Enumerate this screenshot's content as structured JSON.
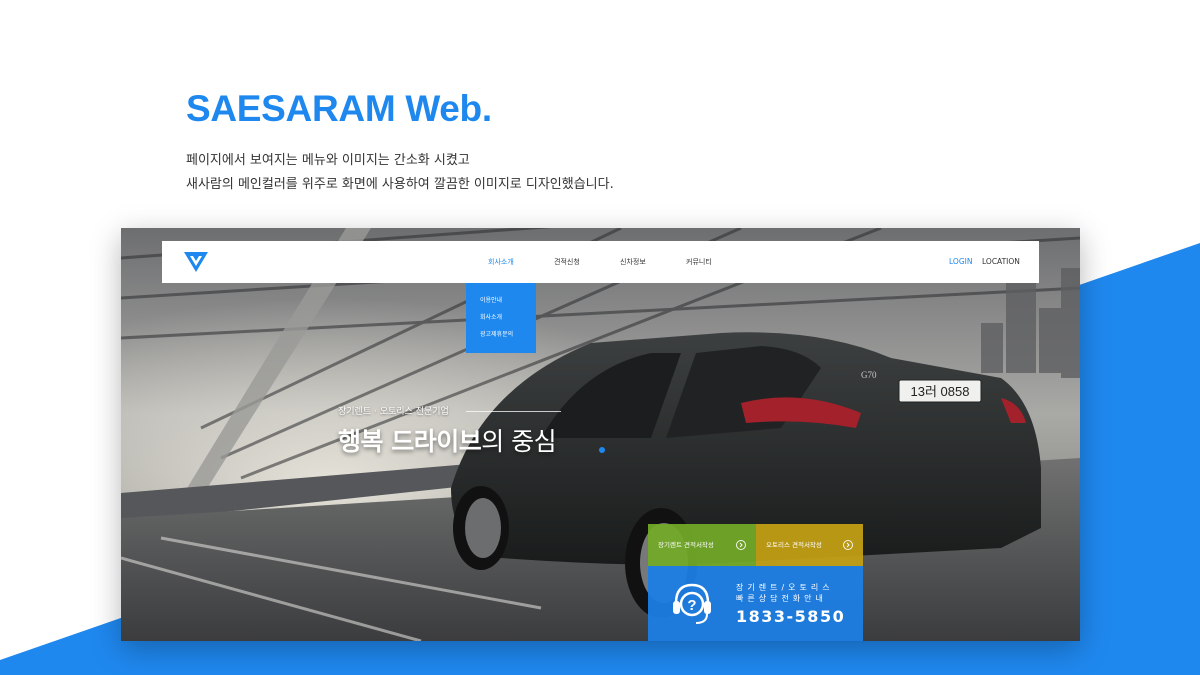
{
  "colors": {
    "accent": "#1e88ee",
    "green_button": "#73aa28",
    "gold_button": "#c4a014",
    "call_box": "#1e7ee4"
  },
  "header": {
    "title": "SAESARAM Web.",
    "desc_line1": "페이지에서 보여지는 메뉴와 이미지는 간소화 시켰고",
    "desc_line2": "새사람의 메인컬러를 위주로 화면에 사용하여 깔끔한 이미지로 디자인했습니다."
  },
  "site": {
    "logo_icon": "triangle-logo-icon",
    "nav": {
      "items": [
        {
          "label": "회사소개",
          "active": true
        },
        {
          "label": "견적신청",
          "active": false
        },
        {
          "label": "신차정보",
          "active": false
        },
        {
          "label": "커뮤니티",
          "active": false
        }
      ],
      "login": "LOGIN",
      "location": "LOCATION"
    },
    "dropdown": {
      "items": [
        "이용안내",
        "회사소개",
        "광고제휴문의"
      ]
    },
    "hero": {
      "subtitle": "장기렌트 · 오토리스 전문기업",
      "title_bold": "행복 드라이브",
      "title_light": "의 중심"
    },
    "car": {
      "badge": "G70",
      "plate": "13러 0858"
    },
    "quick": {
      "rent_quote": "장기렌트 견적서작성",
      "lease_quote": "오토리스 견적서작성"
    },
    "call": {
      "icon": "headset-question-icon",
      "line1": "장기렌트/오토리스",
      "line2": "빠른상담전화안내",
      "number": "1833-5850"
    }
  }
}
